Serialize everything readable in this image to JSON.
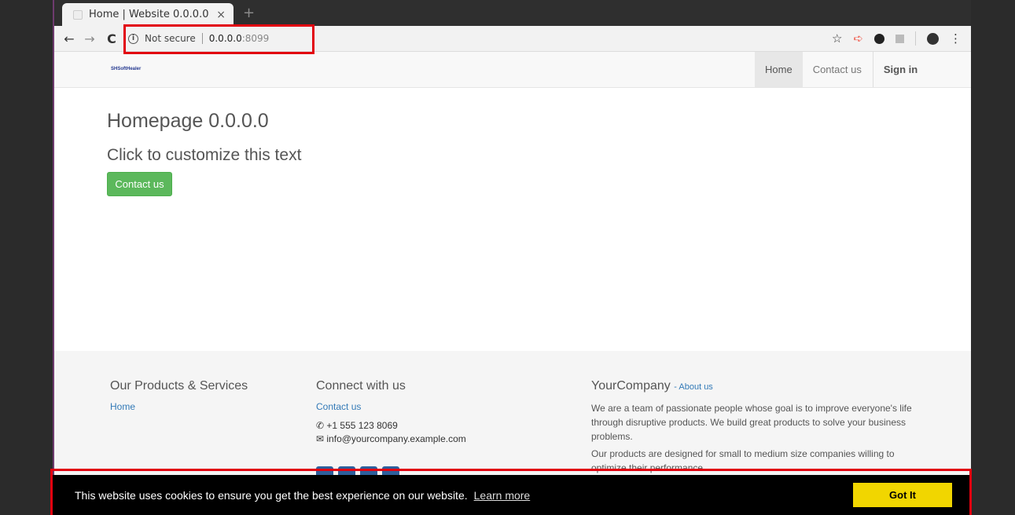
{
  "browser": {
    "tab_title": "Home | Website 0.0.0.0",
    "tab_close": "×",
    "new_tab": "+",
    "security_label": "Not secure",
    "url_host": "0.0.0.0",
    "url_port": ":8099"
  },
  "site": {
    "logo_text": "SHSoftHealer",
    "nav": {
      "home": "Home",
      "contact": "Contact us",
      "signin": "Sign in"
    },
    "hero": {
      "title": "Homepage 0.0.0.0",
      "subtitle": "Click to customize this text",
      "button": "Contact us"
    },
    "footer": {
      "col1": {
        "heading": "Our Products & Services",
        "link": "Home"
      },
      "col2": {
        "heading": "Connect with us",
        "link": "Contact us",
        "phone": "+1 555 123 8069",
        "email": "info@yourcompany.example.com"
      },
      "col3": {
        "heading": "YourCompany",
        "about": "About us",
        "para1": "We are a team of passionate people whose goal is to improve everyone's life through disruptive products. We build great products to solve your business problems.",
        "para2": "Our products are designed for small to medium size companies willing to optimize their performance."
      }
    },
    "cookie": {
      "message": "This website uses cookies to ensure you get the best experience on our website.",
      "learn_more": "Learn more",
      "accept": "Got It"
    }
  },
  "colors": {
    "accent_highlight": "#e2000f",
    "primary_button": "#5cb85c",
    "link": "#337ab7",
    "cookie_button": "#f1d600"
  }
}
